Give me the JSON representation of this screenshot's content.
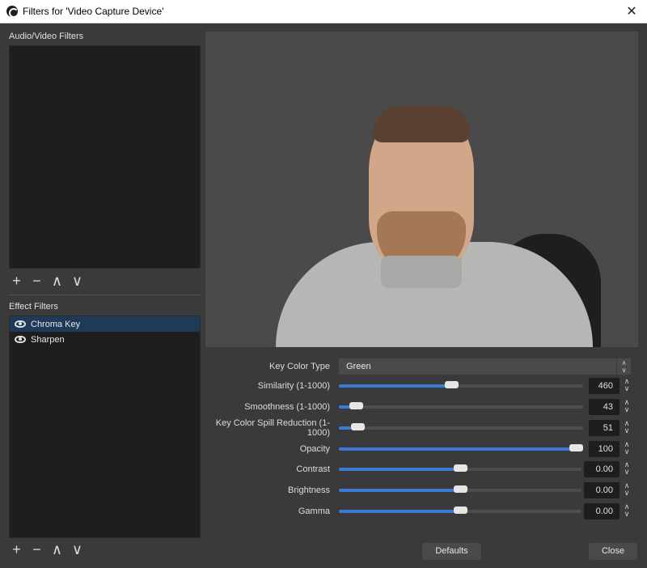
{
  "titlebar": {
    "title": "Filters for 'Video Capture Device'",
    "close_glyph": "✕"
  },
  "audio_video": {
    "label": "Audio/Video Filters",
    "items": []
  },
  "effect": {
    "label": "Effect Filters",
    "items": [
      {
        "label": "Chroma Key",
        "selected": true,
        "visible": true
      },
      {
        "label": "Sharpen",
        "selected": false,
        "visible": true
      }
    ]
  },
  "toolbar": {
    "add": "+",
    "remove": "−",
    "up": "∧",
    "down": "∨"
  },
  "properties": {
    "key_color_type": {
      "label": "Key Color Type",
      "value": "Green"
    },
    "sliders": [
      {
        "label": "Similarity (1-1000)",
        "value": "460",
        "fraction": 0.46
      },
      {
        "label": "Smoothness (1-1000)",
        "value": "43",
        "fraction": 0.043
      },
      {
        "label": "Key Color Spill Reduction (1-1000)",
        "value": "51",
        "fraction": 0.051
      },
      {
        "label": "Opacity",
        "value": "100",
        "fraction": 1.0
      },
      {
        "label": "Contrast",
        "value": "0.00",
        "fraction": 0.5
      },
      {
        "label": "Brightness",
        "value": "0.00",
        "fraction": 0.5
      },
      {
        "label": "Gamma",
        "value": "0.00",
        "fraction": 0.5
      }
    ]
  },
  "buttons": {
    "defaults": "Defaults",
    "close": "Close"
  },
  "colors": {
    "accent": "#3a7bd5",
    "selection": "#1e3a58"
  }
}
